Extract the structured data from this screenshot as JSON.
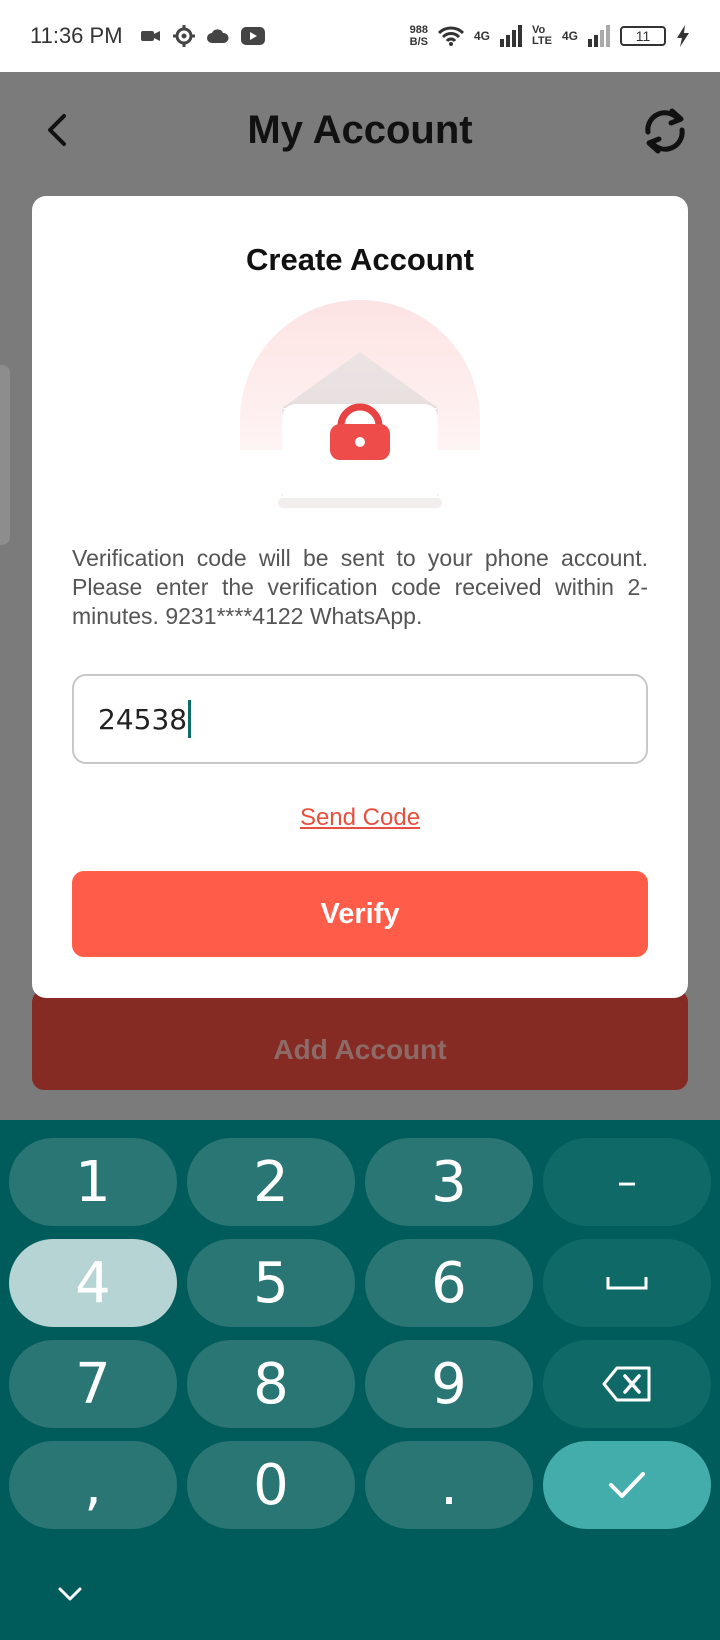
{
  "status_bar": {
    "time": "11:36 PM",
    "net_speed_value": "988",
    "net_speed_unit": "B/S",
    "signal1_label": "4G",
    "volte_label": "Vo\nLTE",
    "signal2_label": "4G",
    "battery": "11",
    "icons": [
      "video-icon",
      "settings-icon",
      "cloud-icon",
      "youtube-icon",
      "wifi-icon",
      "signal-icon",
      "charging-icon"
    ]
  },
  "app_bar": {
    "title": "My Account",
    "back_icon": "chevron-left-icon",
    "refresh_icon": "refresh-icon"
  },
  "modal": {
    "title": "Create Account",
    "illustration_icon": "envelope-lock-icon",
    "description": "Verification code will be sent to your phone account. Please enter the verification code received within 2-minutes. 9231****4122 WhatsApp.",
    "code_value": "24538",
    "send_code_label": "Send Code",
    "verify_label": "Verify"
  },
  "background": {
    "add_account_label": "Add Account"
  },
  "keyboard": {
    "keys": [
      "1",
      "2",
      "3",
      "–",
      "4",
      "5",
      "6",
      "␣",
      "7",
      "8",
      "9",
      "⌫",
      ",",
      "0",
      ".",
      "✓"
    ],
    "pressed_key": "4",
    "collapse_icon": "chevron-down-icon"
  },
  "colors": {
    "accent": "#ff5d49",
    "keyboard_bg": "#005c5a",
    "confirm_key": "#42adab"
  }
}
